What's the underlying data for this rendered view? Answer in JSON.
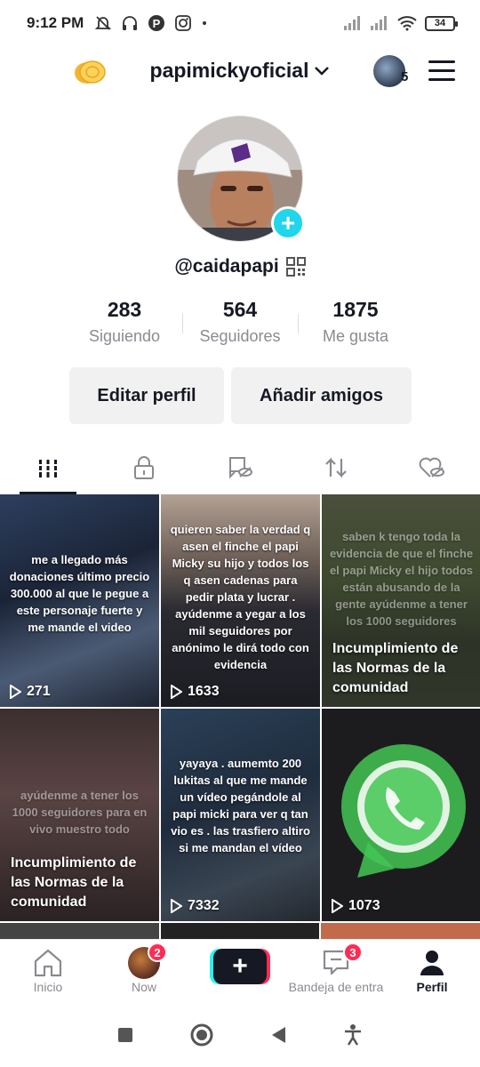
{
  "status_bar": {
    "time": "9:12 PM",
    "battery": "34",
    "icons": [
      "mute-icon",
      "headphones-icon",
      "pinterest-icon",
      "instagram-icon",
      "dot-icon",
      "signal-icon",
      "signal-icon",
      "wifi-icon",
      "battery-icon"
    ]
  },
  "header": {
    "username": "papimickyoficial",
    "avatar_count": "5"
  },
  "profile": {
    "handle": "@caidapapi",
    "stats": [
      {
        "value": "283",
        "label": "Siguiendo"
      },
      {
        "value": "564",
        "label": "Seguidores"
      },
      {
        "value": "1875",
        "label": "Me gusta"
      }
    ],
    "edit_label": "Editar perfil",
    "add_friends_label": "Añadir amigos"
  },
  "tabs": [
    "videos-grid-icon",
    "lock-icon",
    "tag-hidden-icon",
    "repost-icon",
    "liked-hidden-icon"
  ],
  "videos": [
    {
      "text": "me a llegado más donaciones último precio 300.000 al que le pegue a este personaje fuerte y me mande el video",
      "views": "271",
      "blocked": ""
    },
    {
      "text": "quieren saber la verdad q asen el finche el papi Micky su hijo y todos los q asen cadenas para pedir plata y lucrar . ayúdenme a yegar a los mil seguidores por anónimo le dirá todo con evidencia",
      "views": "1633",
      "blocked": ""
    },
    {
      "text": "saben k tengo toda la evidencia de que el finche el papi Micky el hijo todos están abusando de la gente ayúdenme a tener los 1000 seguidores",
      "views": "",
      "blocked": "Incumplimiento de las Normas de la comunidad"
    },
    {
      "text": "ayúdenme a tener los 1000 seguidores para en vivo muestro todo",
      "views": "",
      "blocked": "Incumplimiento de las Normas de la comunidad"
    },
    {
      "text": "yayaya . aumemto 200 lukitas al que me mande un vídeo pegándole al papi micki para ver q tan vio es . las trasfiero altiro si me mandan el vídeo",
      "views": "7332",
      "blocked": ""
    },
    {
      "text": "",
      "views": "1073",
      "blocked": ""
    }
  ],
  "bottom_nav": {
    "home": "Inicio",
    "now": "Now",
    "now_badge": "2",
    "inbox": "Bandeja de entra",
    "inbox_badge": "3",
    "profile": "Perfil"
  }
}
